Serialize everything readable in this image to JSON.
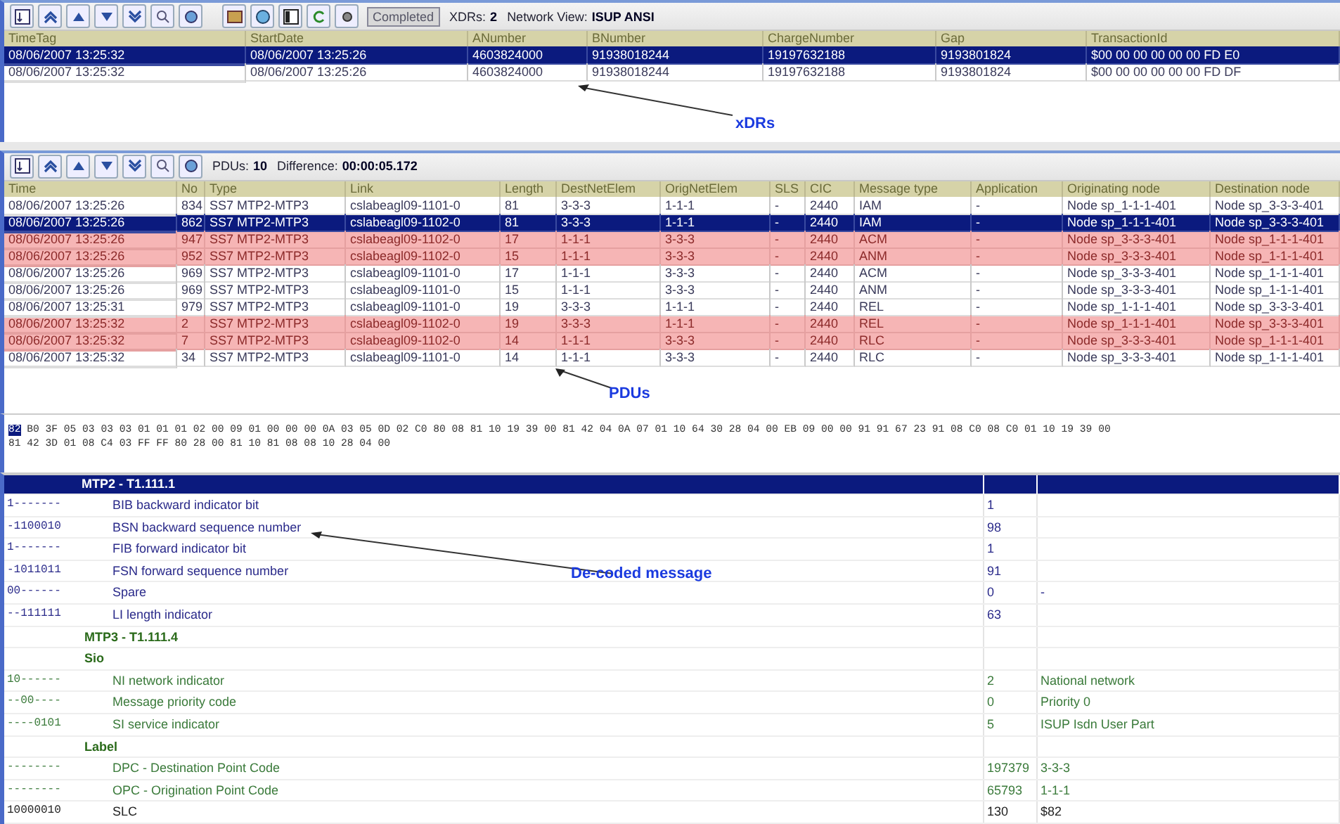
{
  "xdr_panel": {
    "toolbar": {
      "status": "Completed",
      "count_label": "XDRs:",
      "count": "2",
      "view_label": "Network View:",
      "view": "ISUP ANSI"
    },
    "table": {
      "columns": [
        "TimeTag",
        "StartDate",
        "ANumber",
        "BNumber",
        "ChargeNumber",
        "Gap",
        "TransactionId"
      ],
      "rows": [
        {
          "cells": [
            "08/06/2007 13:25:32",
            "08/06/2007 13:25:26",
            "4603824000",
            "91938018244",
            "19197632188",
            "9193801824",
            "$00 00 00 00 00 00 FD E0"
          ],
          "selected": true,
          "flagged": false
        },
        {
          "cells": [
            "08/06/2007 13:25:32",
            "08/06/2007 13:25:26",
            "4603824000",
            "91938018244",
            "19197632188",
            "9193801824",
            "$00 00 00 00 00 00 FD DF"
          ],
          "selected": false,
          "flagged": false
        }
      ]
    },
    "annotation": "xDRs"
  },
  "pdu_panel": {
    "toolbar": {
      "count_label": "PDUs:",
      "count": "10",
      "diff_label": "Difference:",
      "diff": "00:00:05.172"
    },
    "table": {
      "columns": [
        "Time",
        "No",
        "Type",
        "Link",
        "Length",
        "DestNetElem",
        "OrigNetElem",
        "SLS",
        "CIC",
        "Message type",
        "Application",
        "Originating node",
        "Destination node"
      ],
      "rows": [
        {
          "cells": [
            "08/06/2007 13:25:26",
            "834",
            "SS7 MTP2-MTP3",
            "cslabeagl09-1101-0",
            "81",
            "3-3-3",
            "1-1-1",
            "-",
            "2440",
            "IAM",
            "-",
            "Node sp_1-1-1-401",
            "Node sp_3-3-3-401"
          ],
          "selected": false,
          "flagged": false
        },
        {
          "cells": [
            "08/06/2007 13:25:26",
            "862",
            "SS7 MTP2-MTP3",
            "cslabeagl09-1102-0",
            "81",
            "3-3-3",
            "1-1-1",
            "-",
            "2440",
            "IAM",
            "-",
            "Node sp_1-1-1-401",
            "Node sp_3-3-3-401"
          ],
          "selected": true,
          "flagged": false
        },
        {
          "cells": [
            "08/06/2007 13:25:26",
            "947",
            "SS7 MTP2-MTP3",
            "cslabeagl09-1102-0",
            "17",
            "1-1-1",
            "3-3-3",
            "-",
            "2440",
            "ACM",
            "-",
            "Node sp_3-3-3-401",
            "Node sp_1-1-1-401"
          ],
          "selected": false,
          "flagged": true
        },
        {
          "cells": [
            "08/06/2007 13:25:26",
            "952",
            "SS7 MTP2-MTP3",
            "cslabeagl09-1102-0",
            "15",
            "1-1-1",
            "3-3-3",
            "-",
            "2440",
            "ANM",
            "-",
            "Node sp_3-3-3-401",
            "Node sp_1-1-1-401"
          ],
          "selected": false,
          "flagged": true
        },
        {
          "cells": [
            "08/06/2007 13:25:26",
            "969",
            "SS7 MTP2-MTP3",
            "cslabeagl09-1101-0",
            "17",
            "1-1-1",
            "3-3-3",
            "-",
            "2440",
            "ACM",
            "-",
            "Node sp_3-3-3-401",
            "Node sp_1-1-1-401"
          ],
          "selected": false,
          "flagged": false
        },
        {
          "cells": [
            "08/06/2007 13:25:26",
            "969",
            "SS7 MTP2-MTP3",
            "cslabeagl09-1101-0",
            "15",
            "1-1-1",
            "3-3-3",
            "-",
            "2440",
            "ANM",
            "-",
            "Node sp_3-3-3-401",
            "Node sp_1-1-1-401"
          ],
          "selected": false,
          "flagged": false
        },
        {
          "cells": [
            "08/06/2007 13:25:31",
            "979",
            "SS7 MTP2-MTP3",
            "cslabeagl09-1101-0",
            "19",
            "3-3-3",
            "1-1-1",
            "-",
            "2440",
            "REL",
            "-",
            "Node sp_1-1-1-401",
            "Node sp_3-3-3-401"
          ],
          "selected": false,
          "flagged": false
        },
        {
          "cells": [
            "08/06/2007 13:25:32",
            "2",
            "SS7 MTP2-MTP3",
            "cslabeagl09-1102-0",
            "19",
            "3-3-3",
            "1-1-1",
            "-",
            "2440",
            "REL",
            "-",
            "Node sp_1-1-1-401",
            "Node sp_3-3-3-401"
          ],
          "selected": false,
          "flagged": true
        },
        {
          "cells": [
            "08/06/2007 13:25:32",
            "7",
            "SS7 MTP2-MTP3",
            "cslabeagl09-1102-0",
            "14",
            "1-1-1",
            "3-3-3",
            "-",
            "2440",
            "RLC",
            "-",
            "Node sp_3-3-3-401",
            "Node sp_1-1-1-401"
          ],
          "selected": false,
          "flagged": true
        },
        {
          "cells": [
            "08/06/2007 13:25:32",
            "34",
            "SS7 MTP2-MTP3",
            "cslabeagl09-1101-0",
            "14",
            "1-1-1",
            "3-3-3",
            "-",
            "2440",
            "RLC",
            "-",
            "Node sp_3-3-3-401",
            "Node sp_1-1-1-401"
          ],
          "selected": false,
          "flagged": false
        }
      ]
    },
    "annotation": "PDUs"
  },
  "hex_dump": {
    "highlight": "82",
    "lines": [
      "B0 3F 05 03 03 03 01 01 01 02 00 09 01 00 00 00 0A 03 05 0D 02 C0 80 08 81 10 19 39 00 81 42 04 0A 07 01 10 64 30 28 04 00 EB 09 00 00 91 91 67 23 91 08 C0 08 C0 01 10 19 39 00",
      "81 42 3D 01 08 C4 03 FF FF 80 28 00 81 10 81 08 08 10 28 04 00"
    ]
  },
  "decoded": {
    "title": "MTP2 - T1.111.1",
    "rows": [
      {
        "kind": "mtp2",
        "bits": "1-------",
        "field": "BIB backward indicator bit",
        "value": "1",
        "meaning": ""
      },
      {
        "kind": "mtp2",
        "bits": "-1100010",
        "field": "BSN backward sequence number",
        "value": "98",
        "meaning": ""
      },
      {
        "kind": "mtp2",
        "bits": "1-------",
        "field": "FIB forward indicator bit",
        "value": "1",
        "meaning": ""
      },
      {
        "kind": "mtp2",
        "bits": "-1011011",
        "field": "FSN forward sequence number",
        "value": "91",
        "meaning": ""
      },
      {
        "kind": "mtp2",
        "bits": "00------",
        "field": "Spare",
        "value": "0",
        "meaning": "-"
      },
      {
        "kind": "mtp2",
        "bits": "--111111",
        "field": "LI length indicator",
        "value": "63",
        "meaning": ""
      },
      {
        "kind": "heading",
        "bits": "",
        "field": "MTP3 - T1.111.4",
        "value": "",
        "meaning": ""
      },
      {
        "kind": "heading",
        "bits": "",
        "field": "Sio",
        "value": "",
        "meaning": ""
      },
      {
        "kind": "mtp3",
        "bits": "10------",
        "field": "NI network indicator",
        "value": "2",
        "meaning": "National network"
      },
      {
        "kind": "mtp3",
        "bits": "--00----",
        "field": "Message priority code",
        "value": "0",
        "meaning": "Priority 0"
      },
      {
        "kind": "mtp3",
        "bits": "----0101",
        "field": "SI service indicator",
        "value": "5",
        "meaning": "ISUP Isdn User Part"
      },
      {
        "kind": "heading",
        "bits": "",
        "field": "Label",
        "value": "",
        "meaning": ""
      },
      {
        "kind": "mtp3",
        "bits": "--------",
        "field": "DPC - Destination Point Code",
        "value": "197379",
        "meaning": "3-3-3"
      },
      {
        "kind": "mtp3",
        "bits": "--------",
        "field": "OPC - Origination Point Code",
        "value": "65793",
        "meaning": "1-1-1"
      },
      {
        "kind": "plain",
        "bits": "10000010",
        "field": "SLC",
        "value": "130",
        "meaning": "$82"
      }
    ],
    "annotation": "De-coded message"
  }
}
